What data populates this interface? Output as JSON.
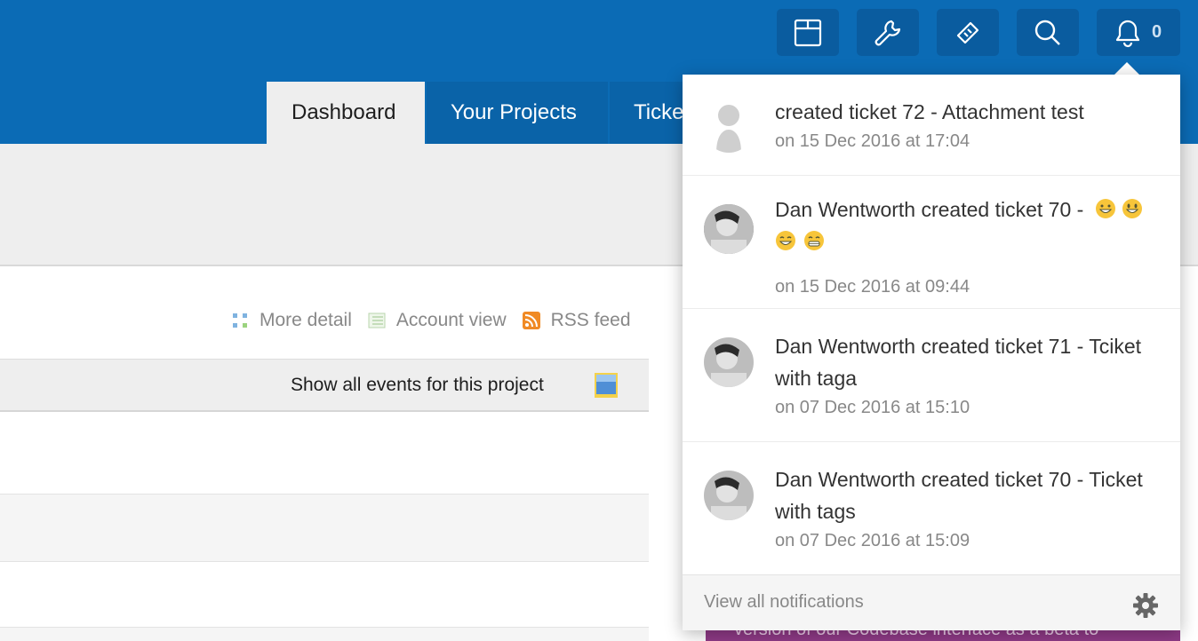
{
  "header": {
    "bell_count": "0",
    "tabs": [
      {
        "label": "Dashboard",
        "active": true
      },
      {
        "label": "Your Projects",
        "active": false
      },
      {
        "label": "Ticke",
        "active": false
      }
    ],
    "icons": [
      "box-icon",
      "wrench-icon",
      "ticket-icon",
      "search-icon",
      "bell-icon"
    ]
  },
  "view_links": {
    "more_detail": "More detail",
    "account_view": "Account view",
    "rss_feed": "RSS feed"
  },
  "events_bar": {
    "label": "Show all events for this project"
  },
  "notifications": {
    "items": [
      {
        "text": "created ticket 72 - Attachment test",
        "time": "on 15 Dec 2016 at 17:04",
        "avatar": "placeholder-person"
      },
      {
        "text": "Dan Wentworth created ticket 70 - ",
        "emojis": [
          "grinning-smile-emoji",
          "smiley-emoji",
          "smile-emoji",
          "grimacing-emoji"
        ],
        "time": "on 15 Dec 2016 at 09:44",
        "avatar": "photo"
      },
      {
        "text": "Dan Wentworth created ticket 71 - Tciket with taga",
        "time": "on 07 Dec 2016 at 15:10",
        "avatar": "photo"
      },
      {
        "text": "Dan Wentworth created ticket 70 - Ticket with tags",
        "time": "on 07 Dec 2016 at 15:09",
        "avatar": "photo"
      }
    ],
    "view_all": "View all notifications"
  },
  "banner": {
    "text": "version of our Codebase interface as a beta to"
  },
  "colors": {
    "header_blue": "#0b6bb5",
    "button_blue": "#0a5c9f",
    "banner_purple": "#8e3a86"
  }
}
